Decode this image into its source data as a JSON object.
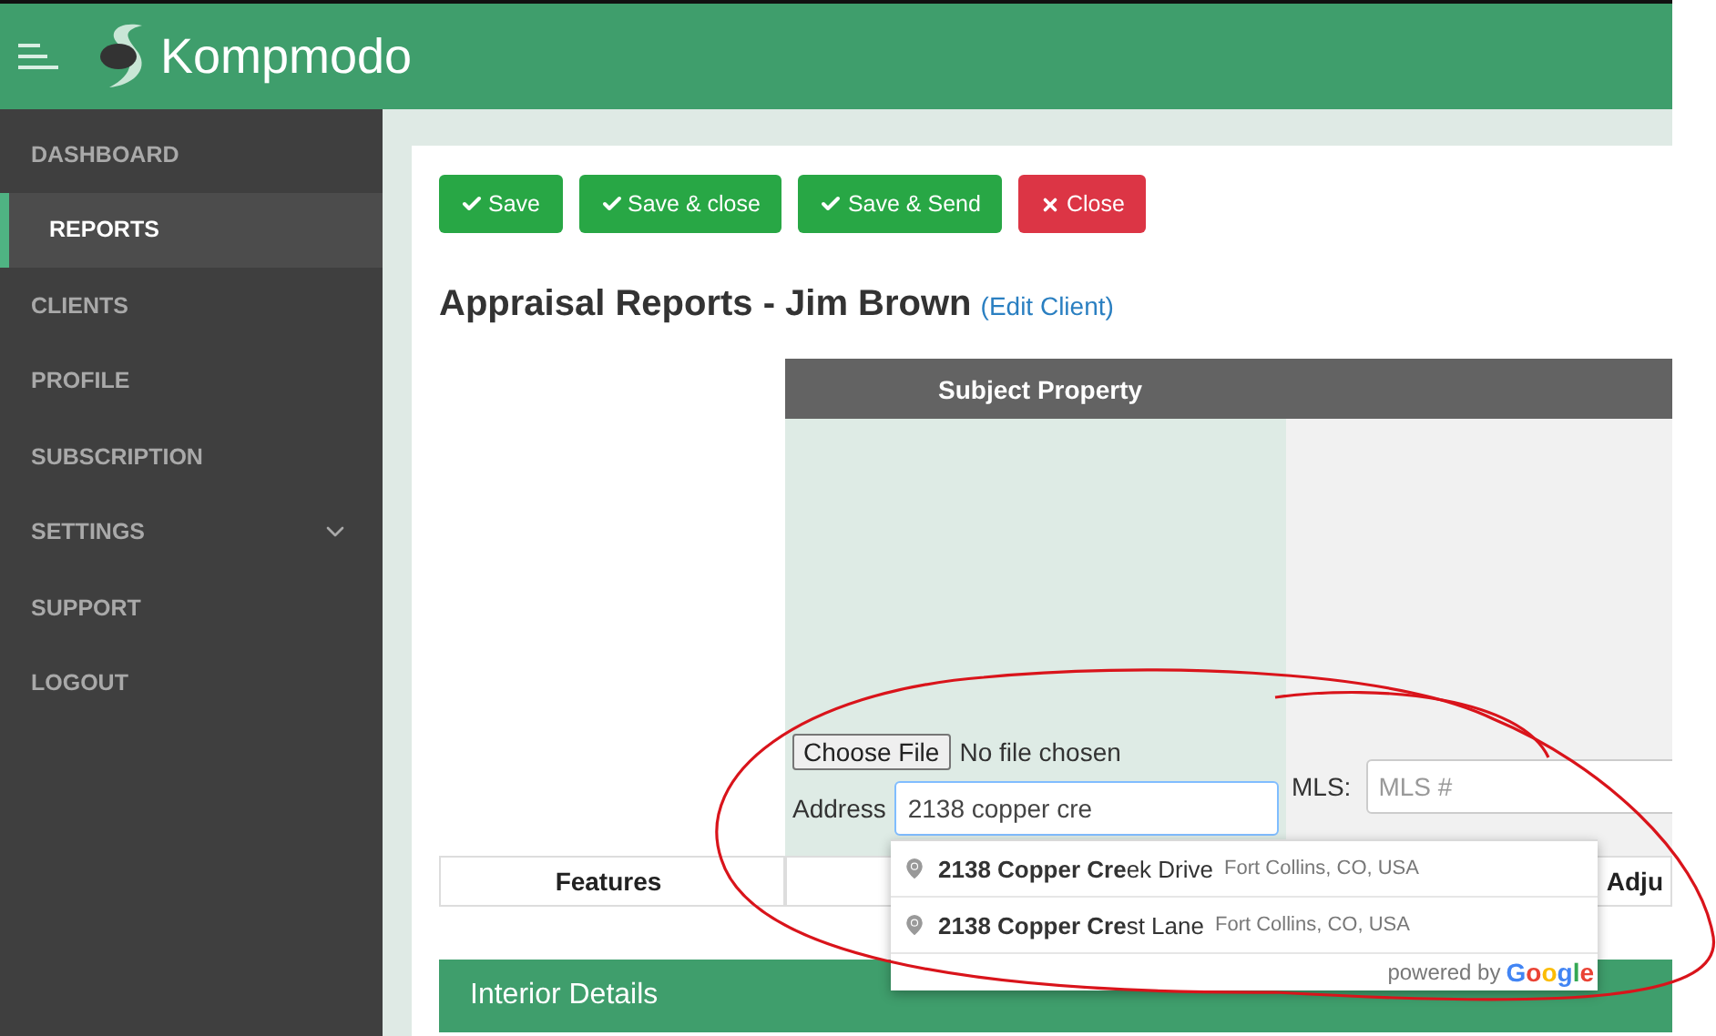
{
  "header": {
    "brand": "Kompmodo"
  },
  "sidebar": {
    "items": [
      {
        "label": "DASHBOARD",
        "selected": false,
        "expandable": false
      },
      {
        "label": "REPORTS",
        "selected": true,
        "expandable": false
      },
      {
        "label": "CLIENTS",
        "selected": false,
        "expandable": false
      },
      {
        "label": "PROFILE",
        "selected": false,
        "expandable": false
      },
      {
        "label": "SUBSCRIPTION",
        "selected": false,
        "expandable": false
      },
      {
        "label": "SETTINGS",
        "selected": false,
        "expandable": true
      },
      {
        "label": "SUPPORT",
        "selected": false,
        "expandable": false
      },
      {
        "label": "LOGOUT",
        "selected": false,
        "expandable": false
      }
    ]
  },
  "toolbar": {
    "buttons": [
      {
        "label": "Save",
        "kind": "confirm"
      },
      {
        "label": "Save & close",
        "kind": "confirm"
      },
      {
        "label": "Save & Send",
        "kind": "confirm"
      },
      {
        "label": "Close",
        "kind": "cancel"
      }
    ]
  },
  "title": {
    "text": "Appraisal Reports - Jim Brown",
    "link": "(Edit Client)"
  },
  "comparison": {
    "header": "Subject Property",
    "file_input": {
      "button": "Choose File",
      "status": "No file chosen"
    },
    "address": {
      "label": "Address",
      "value": "2138 copper cre"
    },
    "mls": {
      "label": "MLS:",
      "placeholder": "MLS #"
    },
    "features_row": {
      "label": "Features",
      "column_3": "Adju"
    }
  },
  "autocomplete": {
    "suggestions": [
      {
        "match": "2138 Copper Cre",
        "rest": "ek Drive",
        "secondary": "Fort Collins, CO, USA"
      },
      {
        "match": "2138 Copper Cre",
        "rest": "st Lane",
        "secondary": "Fort Collins, CO, USA"
      }
    ],
    "attribution": "powered by",
    "brand": "Google"
  },
  "section": {
    "title": "Interior Details"
  }
}
